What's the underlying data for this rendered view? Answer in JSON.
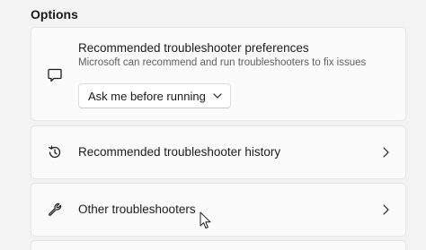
{
  "section": {
    "title": "Options"
  },
  "preferences": {
    "icon": "chat-bubble-icon",
    "title": "Recommended troubleshooter preferences",
    "description": "Microsoft can recommend and run troubleshooters to fix issues",
    "dropdown": {
      "selected": "Ask me before running",
      "icon": "chevron-down-icon"
    }
  },
  "history": {
    "icon": "history-icon",
    "label": "Recommended troubleshooter history",
    "chevron": "chevron-right-icon"
  },
  "other": {
    "icon": "wrench-icon",
    "label": "Other troubleshooters",
    "chevron": "chevron-right-icon"
  },
  "colors": {
    "background": "#f3f3f3",
    "card": "#fbfbfb",
    "border": "#e5e5e5",
    "text": "#1b1b1b",
    "secondary_text": "#5d5d5d"
  }
}
